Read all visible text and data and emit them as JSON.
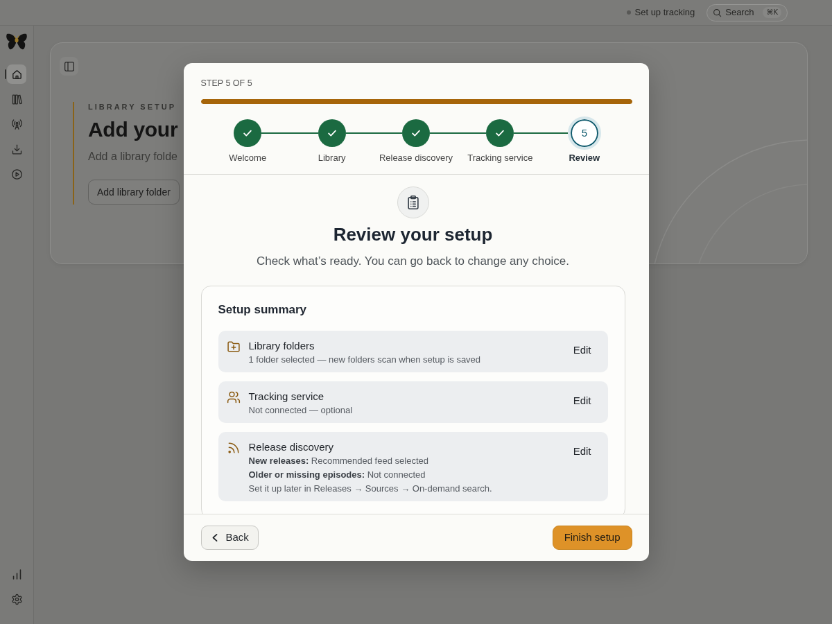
{
  "top_bar": {
    "tracking_status": {
      "label": "Set up tracking"
    },
    "search": {
      "label": "Search",
      "shortcut": "⌘K"
    }
  },
  "sidebar": {
    "items": [
      {
        "selected": true
      },
      {
        "selected": false
      },
      {
        "selected": false
      },
      {
        "selected": false
      },
      {
        "selected": false
      }
    ],
    "footer_items": [
      {
        "selected": false
      },
      {
        "selected": false
      }
    ]
  },
  "page": {
    "eyebrow": "LIBRARY SETUP",
    "heading": "Add your",
    "description": "Add a library folde",
    "button": "Add library folder"
  },
  "dialog": {
    "step_label": "STEP 5 OF 5",
    "progress": {
      "level": 1
    },
    "steps": [
      {
        "label": "Welcome",
        "completed": true,
        "selected": false
      },
      {
        "label": "Library",
        "completed": true,
        "selected": false
      },
      {
        "label": "Release discovery",
        "completed": true,
        "selected": false
      },
      {
        "label": "Tracking service",
        "completed": true,
        "selected": false
      },
      {
        "label": "Review",
        "number": "5",
        "completed": false,
        "selected": true
      }
    ],
    "title": "Review your setup",
    "subtitle": "Check what’s ready. You can go back to change any choice.",
    "summary": {
      "title": "Setup summary",
      "items": [
        {
          "title": "Library folders",
          "lines": [
            "1 folder selected — new folders scan when setup is saved"
          ],
          "action": "Edit"
        },
        {
          "title": "Tracking service",
          "lines": [
            "Not connected — optional"
          ],
          "action": "Edit"
        },
        {
          "title": "Release discovery",
          "lines": [
            "**New releases:** Recommended feed selected",
            "**Older or missing episodes:** Not connected",
            "Set it up later in Releases → Sources → On-demand search."
          ],
          "action": "Edit"
        }
      ]
    },
    "back_button": "Back",
    "finish_button": "Finish setup"
  }
}
